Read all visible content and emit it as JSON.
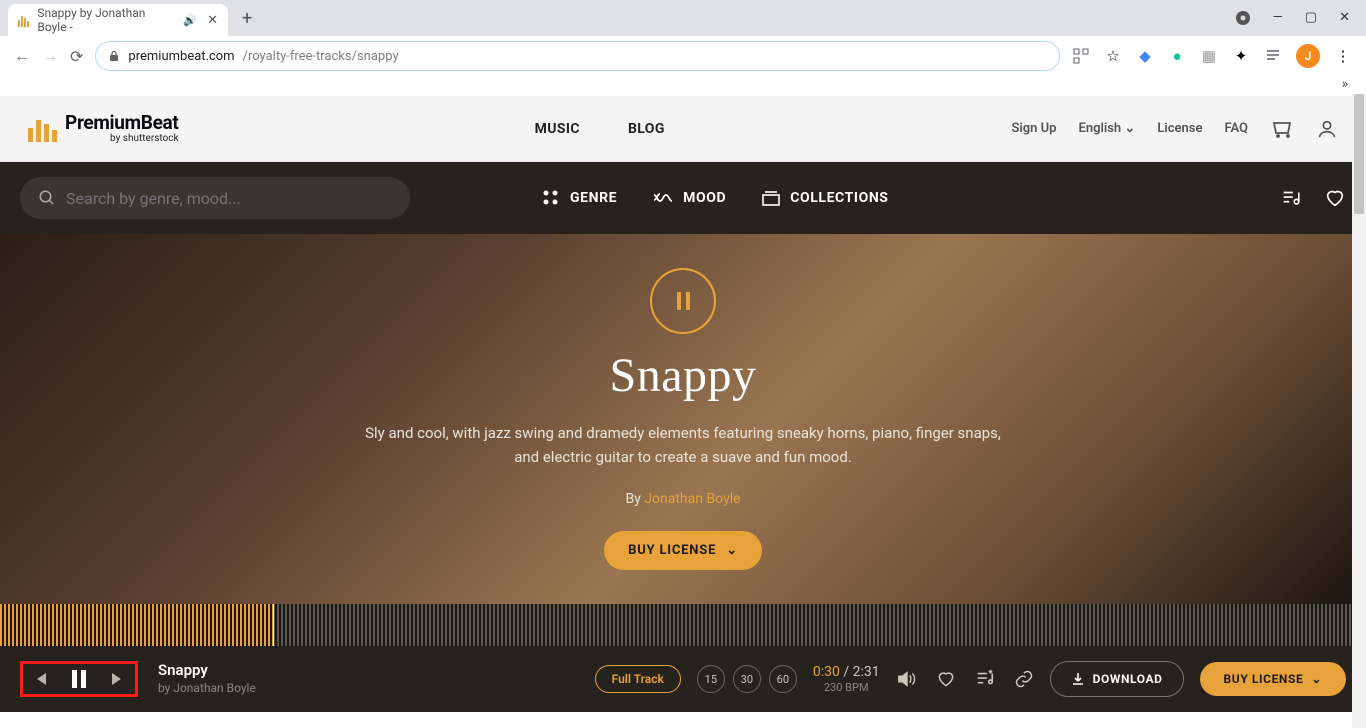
{
  "browser": {
    "tab_title": "Snappy by Jonathan Boyle - ",
    "url_domain": "premiumbeat.com",
    "url_path": "/royalty-free-tracks/snappy",
    "avatar_letter": "J"
  },
  "site_header": {
    "logo_main": "PremiumBeat",
    "logo_sub": "by shutterstock",
    "nav_music": "MUSIC",
    "nav_blog": "BLOG",
    "signup": "Sign Up",
    "language": "English",
    "license": "License",
    "faq": "FAQ"
  },
  "filter_bar": {
    "search_placeholder": "Search by genre, mood...",
    "genre": "GENRE",
    "mood": "MOOD",
    "collections": "COLLECTIONS"
  },
  "hero": {
    "title": "Snappy",
    "description": "Sly and cool, with jazz swing and dramedy elements featuring sneaky horns, piano, finger snaps, and electric guitar to create a suave and fun mood.",
    "by_label": "By ",
    "artist": "Jonathan Boyle",
    "buy_label": "BUY LICENSE"
  },
  "player": {
    "track_title": "Snappy",
    "by_prefix": "by ",
    "artist": "Jonathan Boyle",
    "full_track": "Full Track",
    "skip15": "15",
    "skip30": "30",
    "skip60": "60",
    "elapsed": "0:30",
    "sep": " / ",
    "duration": "2:31",
    "bpm": "230 BPM",
    "download": "DOWNLOAD",
    "buy": "BUY LICENSE"
  }
}
